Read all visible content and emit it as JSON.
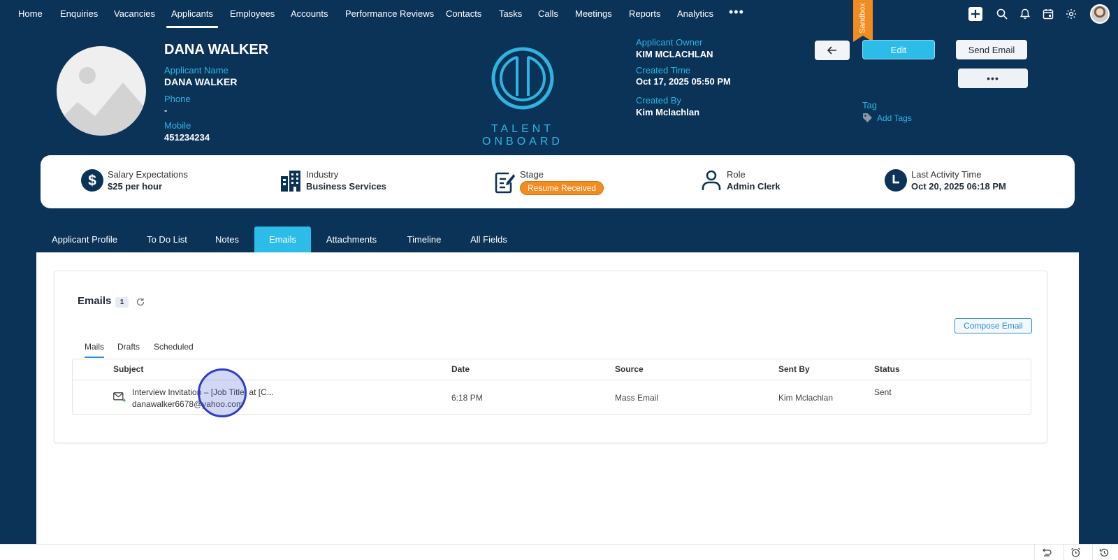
{
  "nav": {
    "items": [
      "Home",
      "Enquiries",
      "Vacancies",
      "Applicants",
      "Employees",
      "Accounts",
      "Performance Reviews",
      "Contacts",
      "Tasks",
      "Calls",
      "Meetings",
      "Reports",
      "Analytics"
    ],
    "active": "Applicants",
    "more": "•••",
    "sandbox": "Sandbox",
    "icons": [
      "plus-icon",
      "search-icon",
      "bell-icon",
      "calendar-icon",
      "gear-icon"
    ]
  },
  "header": {
    "big_name": "DANA WALKER",
    "name_label": "Applicant Name",
    "name_value": "DANA WALKER",
    "phone_label": "Phone",
    "phone_value": "-",
    "mobile_label": "Mobile",
    "mobile_value": "451234234",
    "brand": "TALENT ONBOARD",
    "owner_label": "Applicant Owner",
    "owner_value": "KIM MCLACHLAN",
    "created_time_label": "Created Time",
    "created_time_value": "Oct 17, 2025 05:50 PM",
    "created_by_label": "Created By",
    "created_by_value": "Kim Mclachlan",
    "edit_label": "Edit",
    "send_email_label": "Send Email",
    "more_label": "•••",
    "tag_label": "Tag",
    "add_tags_label": "Add Tags"
  },
  "summary": {
    "salary_label": "Salary Expectations",
    "salary_value": "$25 per hour",
    "industry_label": "Industry",
    "industry_value": "Business Services",
    "stage_label": "Stage",
    "stage_value": "Resume Received",
    "role_label": "Role",
    "role_value": "Admin Clerk",
    "activity_label": "Last Activity Time",
    "activity_value": "Oct 20, 2025 06:18 PM"
  },
  "tabs": [
    "Applicant Profile",
    "To Do List",
    "Notes",
    "Emails",
    "Attachments",
    "Timeline",
    "All Fields"
  ],
  "active_tab": "Emails",
  "emails": {
    "title": "Emails",
    "count": "1",
    "compose_label": "Compose Email",
    "subtabs": [
      "Mails",
      "Drafts",
      "Scheduled"
    ],
    "columns": [
      "Subject",
      "Date",
      "Source",
      "Sent By",
      "Status"
    ],
    "rows": [
      {
        "subject": "Interview Invitation – [Job Title] at [C...",
        "to": "danawalker6678@yahoo.com",
        "date": "6:18 PM",
        "source": "Mass Email",
        "sent_by": "Kim Mclachlan",
        "status": "Sent"
      }
    ]
  },
  "colors": {
    "navy": "#0b3358",
    "accent": "#2bbce7",
    "stage": "#f28b20"
  }
}
